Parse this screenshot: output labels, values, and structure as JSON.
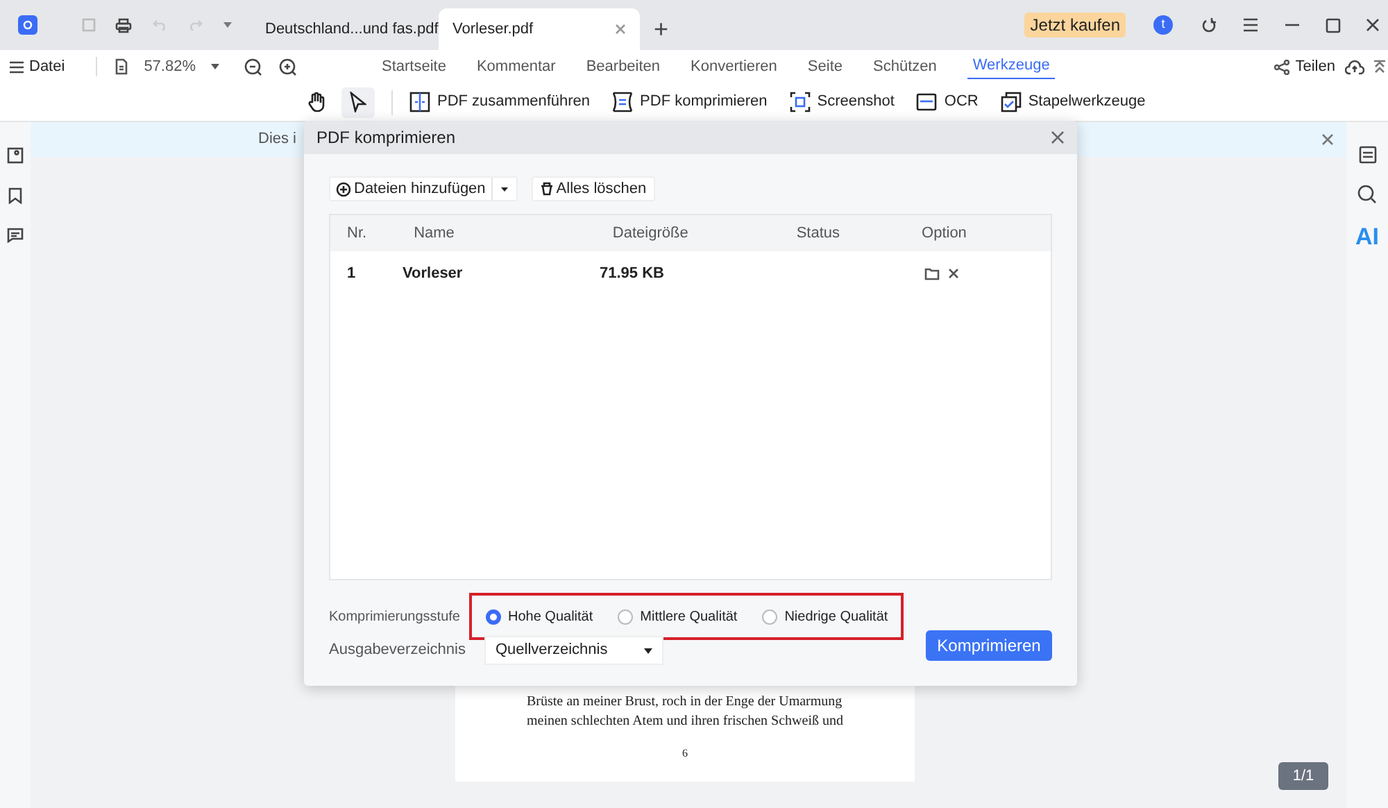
{
  "title_bar": {
    "tabs": [
      {
        "label": "Deutschland...und fas.pdf",
        "selected": false,
        "closable": false
      },
      {
        "label": "Vorleser.pdf",
        "selected": true,
        "closable": true
      }
    ],
    "new_tab": "+",
    "buy_button": "Jetzt kaufen",
    "avatar": "t"
  },
  "menu_bar": {
    "file_menu": "Datei",
    "zoom": "57.82%",
    "tabs": [
      {
        "label": "Startseite",
        "selected": false
      },
      {
        "label": "Kommentar",
        "selected": false
      },
      {
        "label": "Bearbeiten",
        "selected": false
      },
      {
        "label": "Konvertieren",
        "selected": false
      },
      {
        "label": "Seite",
        "selected": false
      },
      {
        "label": "Schützen",
        "selected": false
      },
      {
        "label": "Werkzeuge",
        "selected": true
      }
    ],
    "share": "Teilen"
  },
  "tool_bar": {
    "modes": [
      {
        "kind": "hand",
        "selected": false
      },
      {
        "kind": "cursor",
        "selected": true
      }
    ],
    "tools": [
      {
        "kind": "merge",
        "label": "PDF zusammenführen"
      },
      {
        "kind": "compress",
        "label": "PDF komprimieren"
      },
      {
        "kind": "screenshot",
        "label": "Screenshot"
      },
      {
        "kind": "ocr",
        "label": "OCR"
      },
      {
        "kind": "batch",
        "label": "Stapelwerkzeuge"
      }
    ]
  },
  "banner": {
    "text": "Dies i"
  },
  "document": {
    "lines": [
      "Brüste an meiner Brust, roch in der Enge der Umarmung",
      "meinen schlechten Atem und ihren frischen Schweiß und"
    ],
    "page_number": "6",
    "page_indicator": "1/1"
  },
  "right_sidebar": {
    "ai_label": "AI"
  },
  "dialog": {
    "title": "PDF komprimieren",
    "add_button": "Dateien hinzufügen",
    "clear_button": "Alles löschen",
    "table": {
      "columns": [
        "Nr.",
        "Name",
        "Dateigröße",
        "Status",
        "Option"
      ],
      "rows": [
        {
          "nr": "1",
          "name": "Vorleser",
          "size": "71.95 KB"
        }
      ]
    },
    "level_label": "Komprimierungsstufe",
    "levels": [
      {
        "label": "Hohe Qualität",
        "selected": true
      },
      {
        "label": "Mittlere Qualität",
        "selected": false
      },
      {
        "label": "Niedrige Qualität",
        "selected": false
      }
    ],
    "output_label": "Ausgabeverzeichnis",
    "output_value": "Quellverzeichnis",
    "submit": "Komprimieren"
  }
}
